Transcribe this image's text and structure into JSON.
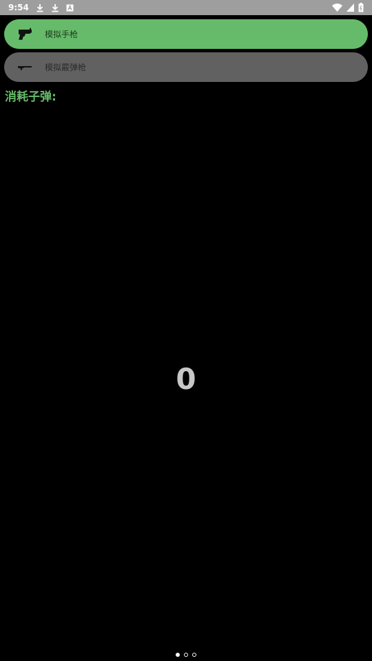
{
  "status_bar": {
    "time": "9:54",
    "left_icons": [
      "download-icon",
      "download-icon",
      "a-notification-icon"
    ],
    "right_icons": [
      "wifi-icon",
      "cellular-signal-icon",
      "battery-icon"
    ]
  },
  "weapons": [
    {
      "label": "模拟手枪",
      "icon": "handgun-icon",
      "selected": true,
      "color": "#66bb6a"
    },
    {
      "label": "模拟霰弹枪",
      "icon": "shotgun-icon",
      "selected": false,
      "color": "#616161"
    }
  ],
  "consumed_label": "消耗子弹:",
  "counter_value": "0",
  "pager": {
    "page_count": 3,
    "current_page": 1
  },
  "colors": {
    "accent": "#66bb6a",
    "background": "#000000",
    "counter": "#c7c7c7",
    "status_bar": "#9e9e9e"
  }
}
